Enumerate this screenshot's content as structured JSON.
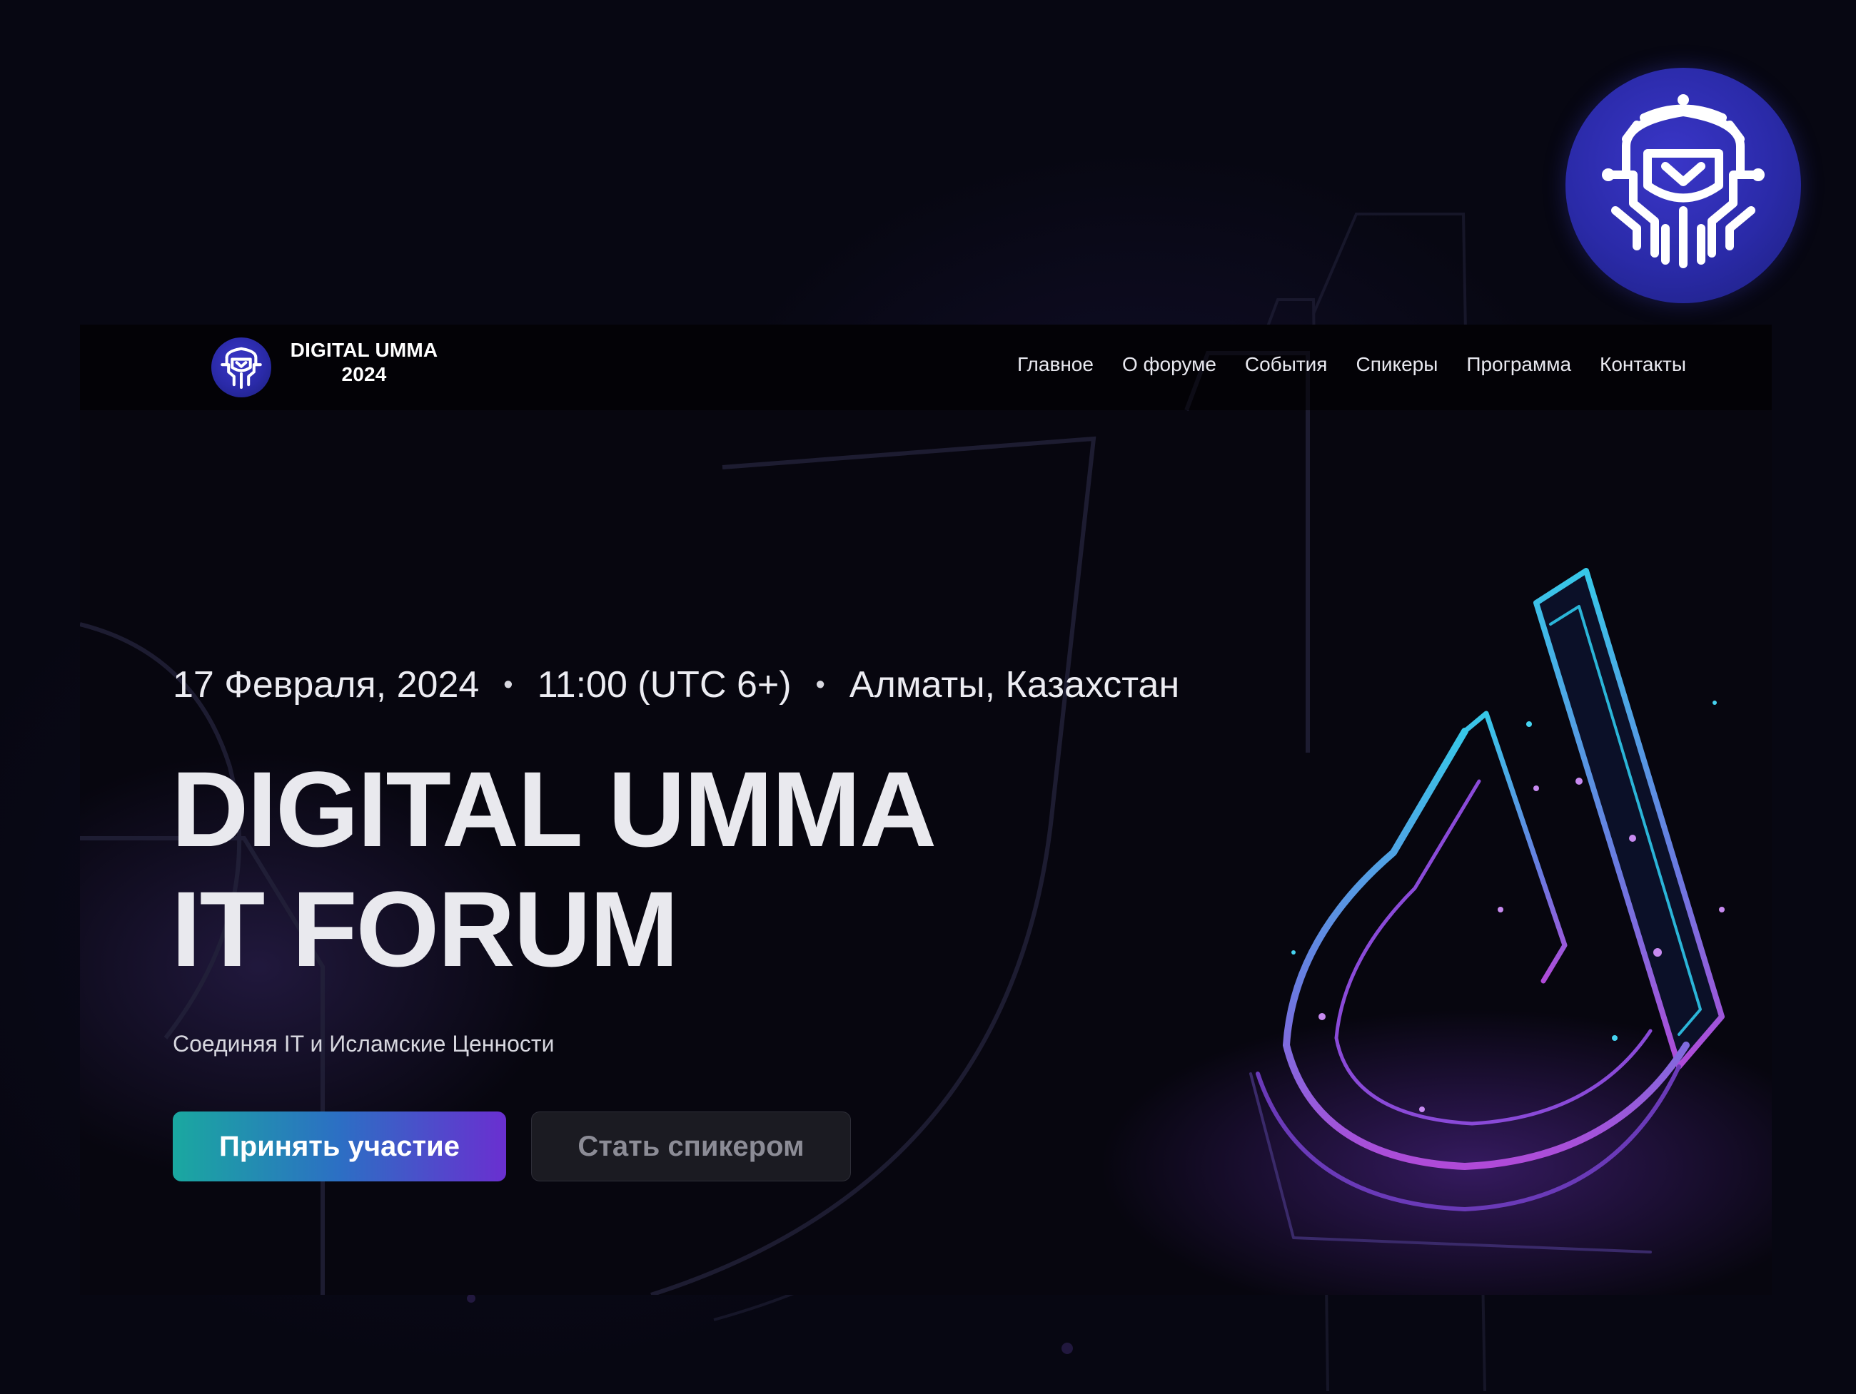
{
  "brand": {
    "name_line1": "DIGITAL UMMA",
    "name_line2": "2024",
    "accent_color": "#2a2aa8"
  },
  "nav": {
    "items": [
      {
        "label": "Главное"
      },
      {
        "label": "О форуме"
      },
      {
        "label": "События"
      },
      {
        "label": "Спикеры"
      },
      {
        "label": "Программа"
      },
      {
        "label": "Контакты"
      }
    ]
  },
  "hero": {
    "date": "17 Февраля, 2024",
    "time": "11:00 (UTC 6+)",
    "location": "Алматы, Казахстан",
    "separator": "•",
    "title_line1": "DIGITAL UMMA",
    "title_line2": "IT FORUM",
    "subtitle": "Соединяя IT и Исламские Ценности",
    "primary_button": "Принять участие",
    "secondary_button": "Стать спикером"
  },
  "icons": {
    "corner_emblem": "digital-umma-emblem-icon",
    "nav_logo": "digital-umma-logo-icon",
    "hero_art": "neon-letter-d-icon"
  }
}
